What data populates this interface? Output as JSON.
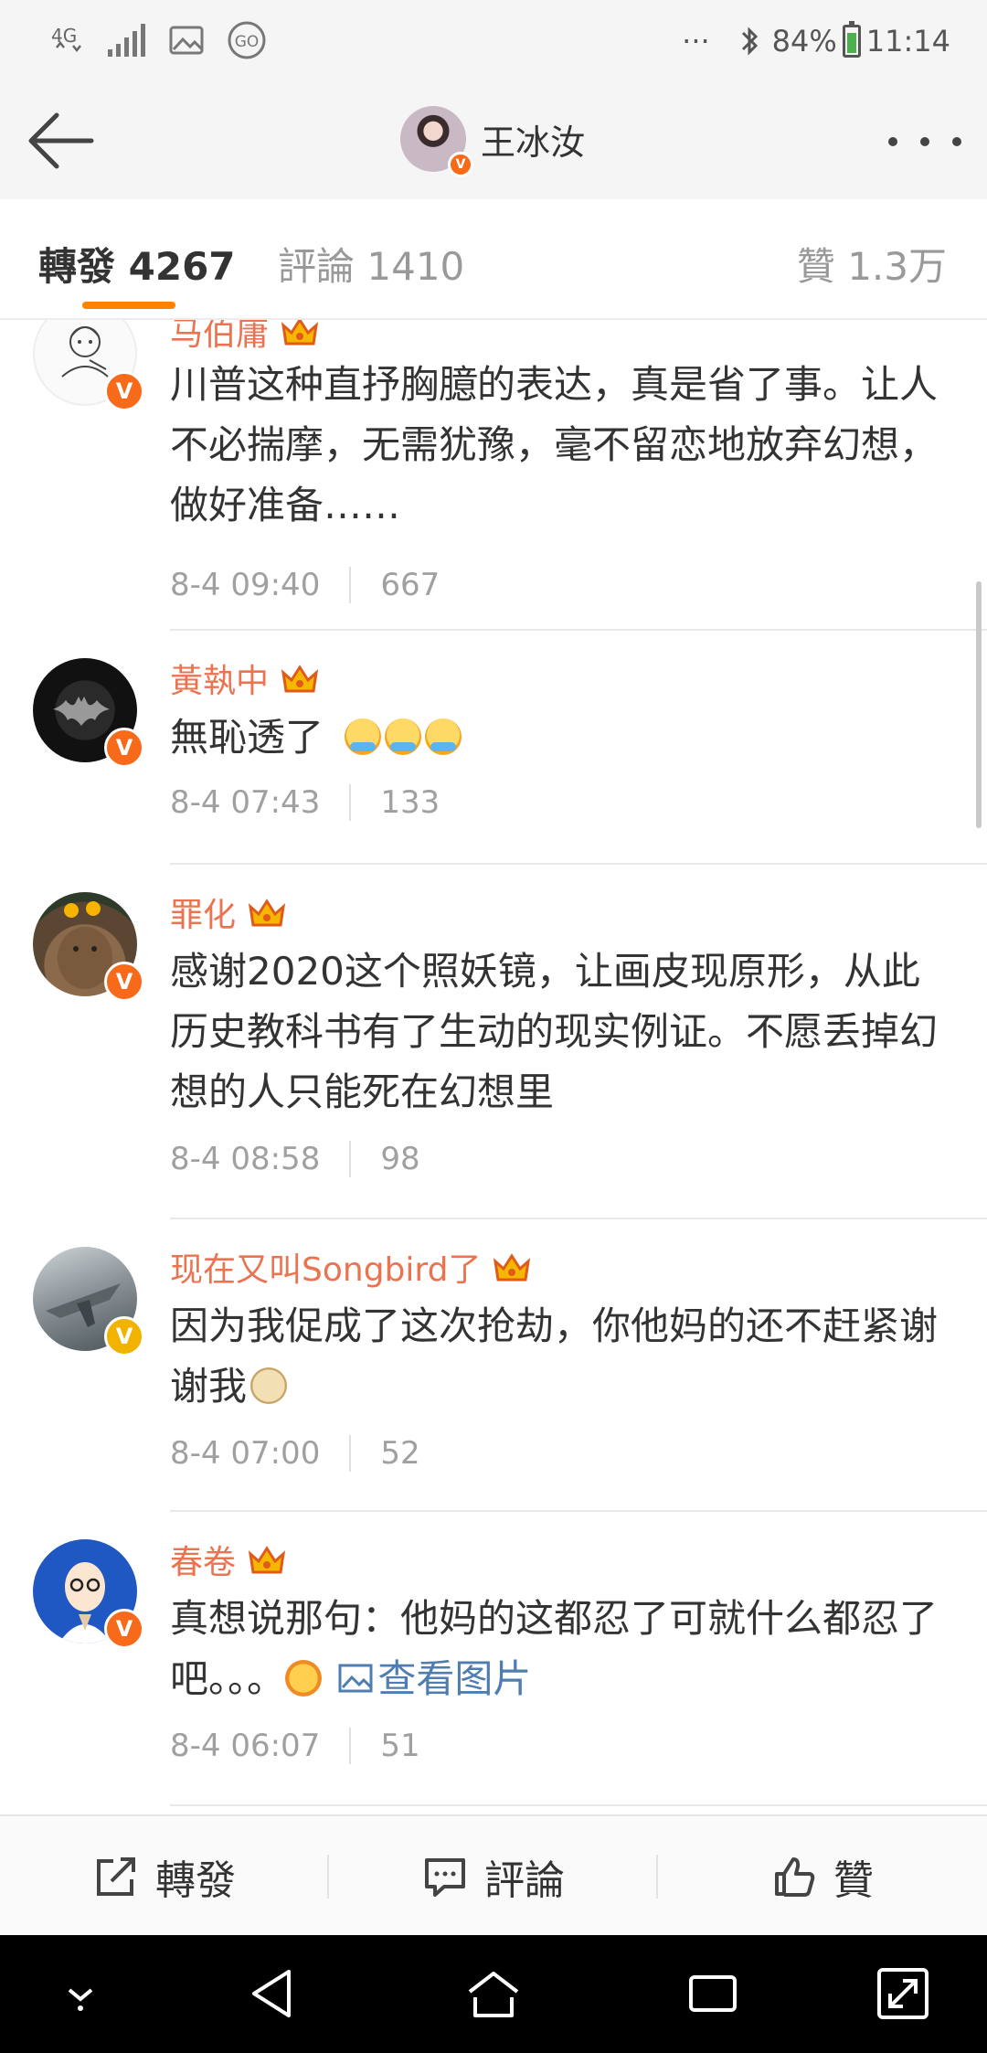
{
  "status_bar": {
    "network": "4G",
    "battery": "84%",
    "time": "11:14",
    "more": "···"
  },
  "header": {
    "title": "王冰汝"
  },
  "tabs": [
    {
      "label": "轉發",
      "count": "4267"
    },
    {
      "label": "評論",
      "count": "1410"
    },
    {
      "label": "贊",
      "count": "1.3万"
    }
  ],
  "comments": [
    {
      "name": "马伯庸",
      "text": "川普这种直抒胸臆的表达，真是省了事。让人不必揣摩，无需犹豫，毫不留恋地放弃幻想，做好准备……",
      "time": "8-4 09:40",
      "likes": "667"
    },
    {
      "name": "黃執中",
      "text": "無恥透了",
      "time": "8-4 07:43",
      "likes": "133"
    },
    {
      "name": "罪化",
      "text": "感谢2020这个照妖镜，让画皮现原形，从此历史教科书有了生动的现实例证。不愿丢掉幻想的人只能死在幻想里",
      "time": "8-4 08:58",
      "likes": "98"
    },
    {
      "name": "现在又叫Songbird了",
      "text": "因为我促成了这次抢劫，你他妈的还不赶紧谢谢我",
      "time": "8-4 07:00",
      "likes": "52"
    },
    {
      "name": "春卷",
      "text": "真想说那句：他妈的这都忍了可就什么都忍了吧。。。",
      "link": "查看图片",
      "time": "8-4 06:07",
      "likes": "51"
    }
  ],
  "actions": {
    "repost": "轉發",
    "comment": "評論",
    "like": "贊"
  },
  "colors": {
    "accent": "#ff8200",
    "username": "#eb7350",
    "link": "#507daf",
    "verified": "#f66a1a"
  }
}
